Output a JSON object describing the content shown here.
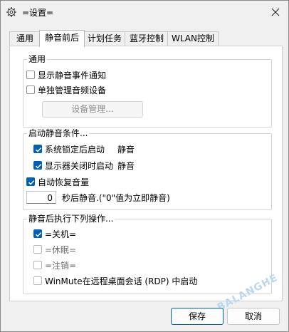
{
  "window": {
    "title": "=设置=",
    "watermark": "BALANGHE"
  },
  "tabs": [
    {
      "label": "通用",
      "active": false
    },
    {
      "label": "静音前后",
      "active": true
    },
    {
      "label": "计划任务",
      "active": false
    },
    {
      "label": "蓝牙控制",
      "active": false
    },
    {
      "label": "WLAN控制",
      "active": false
    }
  ],
  "general_group": {
    "title": "通用",
    "options": [
      {
        "label": "显示静音事件通知",
        "checked": false
      },
      {
        "label": "单独管理音频设备",
        "checked": false
      }
    ],
    "device_button": "设备管理..."
  },
  "mute_condition_group": {
    "title": "启动静音条件...",
    "options": [
      {
        "label": "系统锁定后启动",
        "value": "静音",
        "checked": true
      },
      {
        "label": "显示器关闭时启动",
        "value": "静音",
        "checked": true
      }
    ],
    "auto_restore": {
      "label": "自动恢复音量",
      "checked": true
    },
    "delay": {
      "value": "0",
      "label": "秒后静音.(\"0\"值为立即静音)"
    }
  },
  "after_mute_group": {
    "title": "静音后执行下列操作...",
    "actions": [
      {
        "label": "=关机=",
        "checked": true
      },
      {
        "label": "=休眠=",
        "checked": false
      },
      {
        "label": "=注销=",
        "checked": false
      },
      {
        "label": "WinMute在远程桌面会话 (RDP) 中启动",
        "checked": false
      }
    ]
  },
  "footer": {
    "save_label": "保存",
    "cancel_label": "取消"
  },
  "colors": {
    "accent": "#005fb8"
  }
}
